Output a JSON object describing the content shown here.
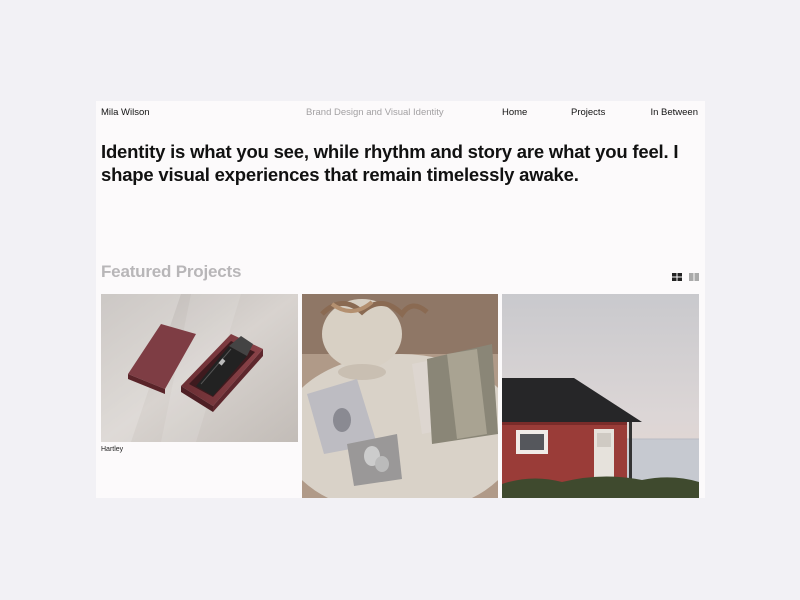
{
  "header": {
    "brand": "Mila Wilson",
    "tagline": "Brand Design and Visual Identity",
    "nav": [
      "Home",
      "Projects",
      "In Between"
    ]
  },
  "hero": {
    "headline": "Identity is what you see, while rhythm and story are what you feel. I shape visual experiences that remain timelessly awake."
  },
  "featured": {
    "title": "Featured Projects",
    "view_icons": [
      "grid-view-icon",
      "columns-view-icon"
    ],
    "projects": [
      {
        "label": "Hartley"
      }
    ]
  },
  "colors": {
    "page_background": "#f2f1f5",
    "frame_background": "#fcfafb",
    "text": "#141414",
    "muted": "#a3a1a3",
    "section_title": "#b8b6b8"
  }
}
